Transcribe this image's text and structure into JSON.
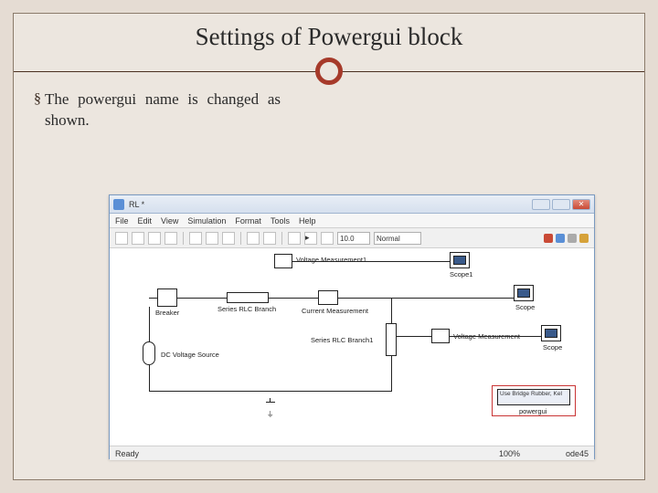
{
  "slide": {
    "title": "Settings of Powergui block",
    "bullet_text": "The powergui name is changed as shown."
  },
  "window": {
    "title": "RL *",
    "menus": [
      "File",
      "Edit",
      "View",
      "Simulation",
      "Format",
      "Tools",
      "Help"
    ],
    "toolbar": {
      "time_field": "10.0",
      "mode": "Normal"
    },
    "statusbar": {
      "left": "Ready",
      "center": "100%",
      "right": "ode45"
    }
  },
  "canvas": {
    "voltage_measurement_top": "Voltage Measurement1",
    "scope_top": "Scope1",
    "scope_mid": "Scope",
    "scope_right": "Scope",
    "breaker": "Breaker",
    "rlc": "Series RLC Branch",
    "current_meas": "Current Measurement",
    "rlc1": "Series RLC Branch1",
    "voltage_meas_right": "Voltage Measurement",
    "dc_source": "DC Voltage Source",
    "powergui_box": "Use Bridge Rubber, Kel",
    "powergui_label": "powergui"
  }
}
